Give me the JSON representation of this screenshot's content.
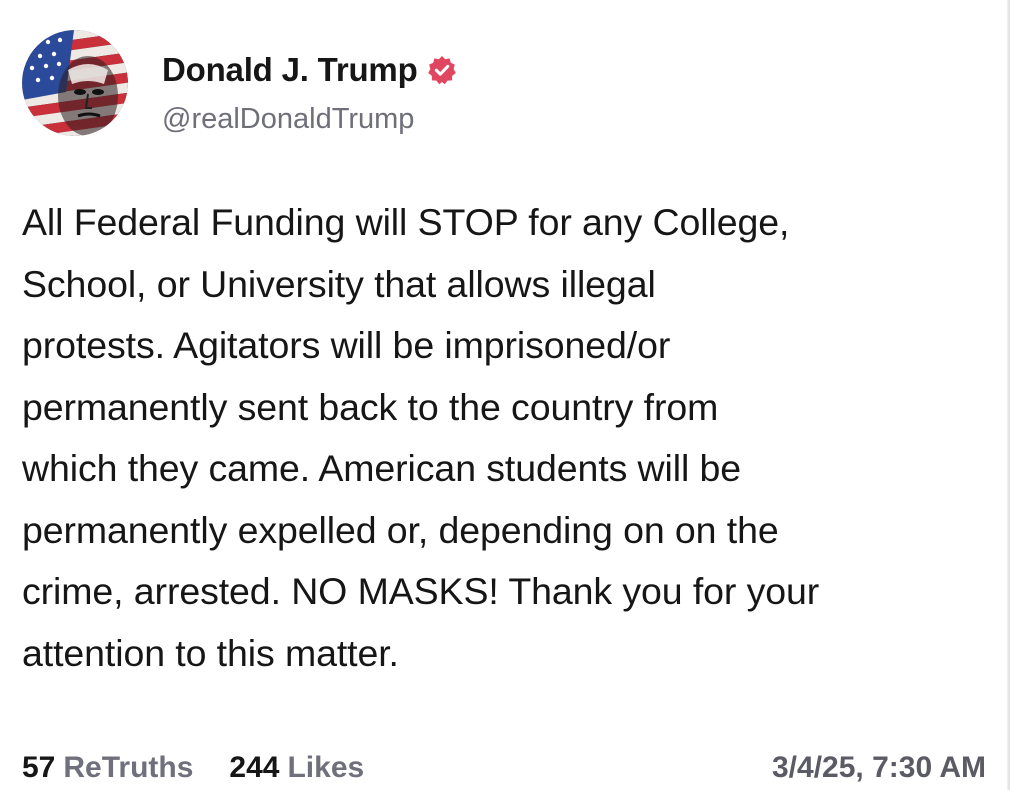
{
  "post": {
    "author": {
      "display_name": "Donald J. Trump",
      "handle": "@realDonaldTrump",
      "verified": true,
      "verified_color": "#e0465f"
    },
    "text": "All Federal Funding will STOP for any College,\nSchool, or University that allows illegal\nprotests. Agitators will be imprisoned/or\npermanently sent back to the country from\nwhich they came. American students will be\npermanently expelled or, depending on on the\ncrime, arrested. NO MASKS! Thank you for your\nattention to this matter.",
    "stats": {
      "retruths_count": "57",
      "retruths_label": "ReTruths",
      "likes_count": "244",
      "likes_label": "Likes"
    },
    "timestamp": "3/4/25, 7:30 AM"
  },
  "icons": {
    "avatar": "american-flag-portrait-avatar",
    "verified": "verified-badge-icon"
  }
}
